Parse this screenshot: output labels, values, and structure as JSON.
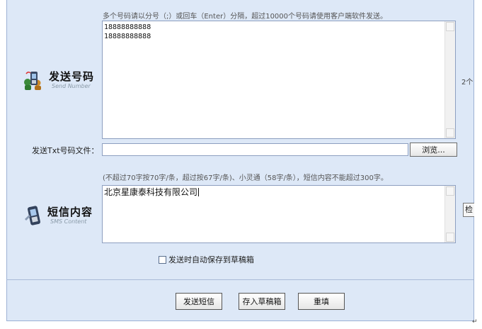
{
  "send_section": {
    "hint": "多个号码请以分号（;）或回车（Enter）分隔，超过10000个号码请使用客户端软件发送。",
    "label_main": "发送号码",
    "label_sub": "Send Number",
    "icon": "phone-contacts-icon",
    "numbers_text": "18888888888\n18888888888",
    "side_count": "2个"
  },
  "file_row": {
    "label": "发送Txt号码文件：",
    "value": "",
    "browse_label": "浏览..."
  },
  "content_section": {
    "hint": "(不超过70字按70字/条，超过按67字/条)、小灵通（58字/条），短信内容不能超过300字。",
    "label_main": "短信内容",
    "label_sub": "SMS Content",
    "icon": "mobile-sms-icon",
    "content_text": "北京星康泰科技有限公司",
    "side_button": "检"
  },
  "autosave": {
    "label": "发送时自动保存到草稿箱",
    "checked": false
  },
  "actions": {
    "send": "发送短信",
    "save_draft": "存入草稿箱",
    "reset": "重填"
  },
  "footer_mark": "↵",
  "colors": {
    "panel_bg": "#dde8f7",
    "border": "#8d9fc0"
  }
}
